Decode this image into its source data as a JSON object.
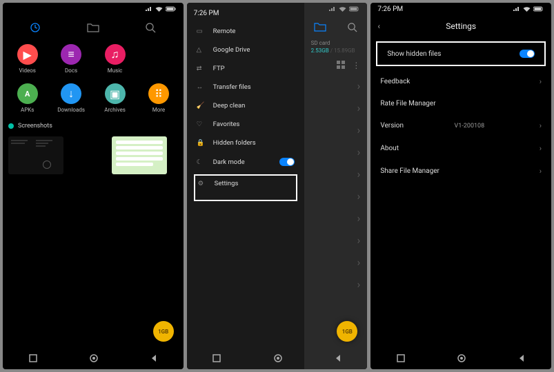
{
  "status": {
    "time": "7:26 PM"
  },
  "screen1": {
    "categories": [
      {
        "label": "Videos",
        "color": "#ff4d4d",
        "glyph": "▶"
      },
      {
        "label": "Docs",
        "color": "#9c27b0",
        "glyph": "≡"
      },
      {
        "label": "Music",
        "color": "#e91e63",
        "glyph": "♫"
      },
      {
        "label": "APKs",
        "color": "#4caf50",
        "glyph": "A"
      },
      {
        "label": "Downloads",
        "color": "#2196f3",
        "glyph": "↓"
      },
      {
        "label": "Archives",
        "color": "#4db6ac",
        "glyph": "▣"
      },
      {
        "label": "More",
        "color": "#ff9800",
        "glyph": "⋮⋮"
      }
    ],
    "section_title": "Screenshots",
    "fab_label": "1GB"
  },
  "screen2": {
    "time": "7:26 PM",
    "menu": [
      {
        "icon": "remote-icon",
        "label": "Remote"
      },
      {
        "icon": "gdrive-icon",
        "label": "Google Drive"
      },
      {
        "icon": "ftp-icon",
        "label": "FTP"
      },
      {
        "icon": "transfer-icon",
        "label": "Transfer files"
      },
      {
        "icon": "clean-icon",
        "label": "Deep clean"
      },
      {
        "icon": "favorites-icon",
        "label": "Favorites"
      },
      {
        "icon": "hidden-icon",
        "label": "Hidden folders"
      },
      {
        "icon": "darkmode-icon",
        "label": "Dark mode",
        "toggle": true
      },
      {
        "icon": "settings-icon",
        "label": "Settings",
        "highlighted": true
      }
    ],
    "storage": {
      "name": "SD card",
      "used": "2.53GB",
      "total": "15.89GB"
    },
    "fab_label": "1GB"
  },
  "screen3": {
    "time": "7:26 PM",
    "title": "Settings",
    "rows": [
      {
        "label": "Show hidden files",
        "type": "toggle",
        "highlighted": true
      },
      {
        "label": "Feedback",
        "type": "link"
      },
      {
        "label": "Rate File Manager",
        "type": "link"
      },
      {
        "label": "Version",
        "type": "value",
        "value": "V1-200108"
      },
      {
        "label": "About",
        "type": "link"
      },
      {
        "label": "Share File Manager",
        "type": "link"
      }
    ]
  }
}
